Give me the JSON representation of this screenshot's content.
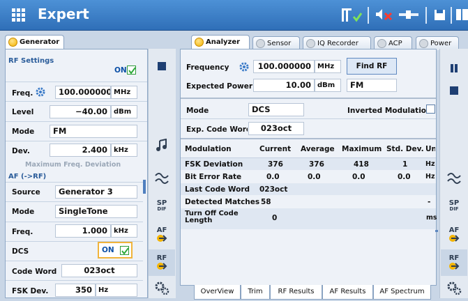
{
  "app": {
    "title": "Expert"
  },
  "generator": {
    "tab_label": "Generator",
    "rf_settings_title": "RF Settings",
    "on_label": "ON",
    "freq_label": "Freq.",
    "freq_value": "100.000000",
    "freq_unit": "MHz",
    "level_label": "Level",
    "level_value": "−40.00",
    "level_unit": "dBm",
    "mode_label": "Mode",
    "mode_value": "FM",
    "dev_label": "Dev.",
    "dev_value": "2.400",
    "dev_unit": "kHz",
    "dev_caption": "Maximum Freq. Deviation",
    "af_title": "AF (->RF)",
    "source_label": "Source",
    "source_value": "Generator 3",
    "af_mode_label": "Mode",
    "af_mode_value": "SingleTone",
    "af_freq_label": "Freq.",
    "af_freq_value": "1.000",
    "af_freq_unit": "kHz",
    "dcs_label": "DCS",
    "dcs_on_label": "ON",
    "code_word_label": "Code Word",
    "code_word_value": "023oct",
    "fsk_label": "FSK Dev.",
    "fsk_value": "350",
    "fsk_unit": "Hz"
  },
  "analyzer": {
    "tabs": [
      {
        "label": "Analyzer"
      },
      {
        "label": "Sensor"
      },
      {
        "label": "IQ Recorder"
      },
      {
        "label": "ACP"
      },
      {
        "label": "Power"
      }
    ],
    "frequency_label": "Frequency",
    "frequency_value": "100.000000",
    "frequency_unit": "MHz",
    "find_rf_label": "Find RF",
    "expected_power_label": "Expected Power",
    "expected_power_value": "10.00",
    "expected_power_unit": "dBm",
    "demod_value": "FM",
    "mode_label": "Mode",
    "mode_value": "DCS",
    "inverted_label": "Inverted Modulatio",
    "exp_code_label": "Exp. Code Word",
    "exp_code_value": "023oct",
    "table_headers": [
      "Modulation",
      "Current",
      "Average",
      "Maximum",
      "Std. Dev.",
      "Unit"
    ],
    "rows": [
      {
        "name": "FSK Deviation",
        "current": "376",
        "average": "376",
        "maximum": "418",
        "std": "1",
        "unit": "Hz"
      },
      {
        "name": "Bit Error Rate",
        "current": "0.0",
        "average": "0.0",
        "maximum": "0.0",
        "std": "0.0",
        "unit": "Hz"
      },
      {
        "name": "Last Code Word",
        "current": "023oct",
        "average": "",
        "maximum": "",
        "std": "",
        "unit": ""
      },
      {
        "name": "Detected Matches",
        "current": "58",
        "average": "",
        "maximum": "",
        "std": "",
        "unit": "-"
      },
      {
        "name": "Turn Off Code\nLength",
        "current": "0",
        "average": "",
        "maximum": "",
        "std": "",
        "unit": "ms"
      }
    ],
    "bottom_tabs": [
      {
        "label": "OverView"
      },
      {
        "label": "Trim"
      },
      {
        "label": "RF Results"
      },
      {
        "label": "AF Results"
      },
      {
        "label": "AF Spectrum"
      }
    ]
  },
  "sidebar": {
    "sp_label": "SP",
    "sp_sub": "DIF",
    "af_label": "AF",
    "rf_label": "RF",
    "rf_sub": "com"
  },
  "colors": {
    "title_bar": "#3a7fc9",
    "accent_orange": "#f4b400",
    "panel_bg": "#e8eef6",
    "check_green": "#2eaa3a"
  }
}
